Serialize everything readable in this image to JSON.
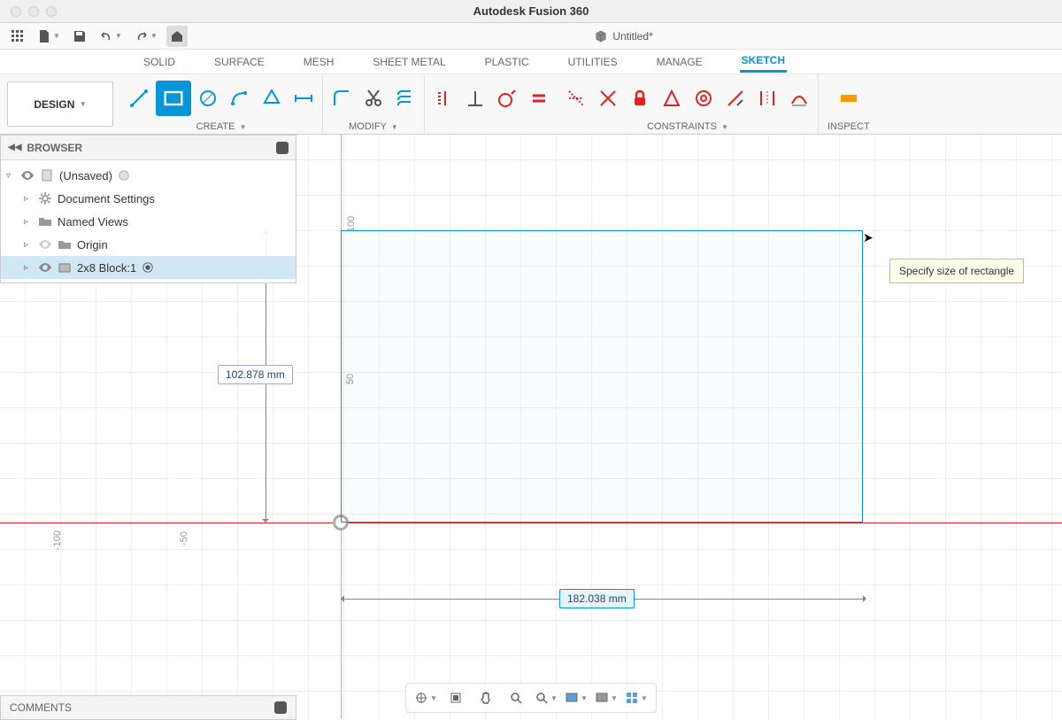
{
  "app": {
    "title": "Autodesk Fusion 360",
    "document": "Untitled*"
  },
  "workspace": {
    "label": "DESIGN"
  },
  "ribbon_tabs": [
    "SOLID",
    "SURFACE",
    "MESH",
    "SHEET METAL",
    "PLASTIC",
    "UTILITIES",
    "MANAGE",
    "SKETCH"
  ],
  "ribbon_active": "SKETCH",
  "ribbon_groups": {
    "create": "CREATE",
    "modify": "MODIFY",
    "constraints": "CONSTRAINTS",
    "inspect": "INSPECT"
  },
  "browser": {
    "title": "BROWSER",
    "root": "(Unsaved)",
    "items": [
      {
        "label": "Document Settings"
      },
      {
        "label": "Named Views"
      },
      {
        "label": "Origin"
      },
      {
        "label": "2x8 Block:1",
        "selected": true
      }
    ]
  },
  "canvas": {
    "axis_ticks_x": {
      "n100": "-100",
      "n50": "-50"
    },
    "axis_ticks_y": {
      "p100": "100",
      "p50": "50"
    },
    "height_dim": "102.878 mm",
    "width_dim": "182.038 mm",
    "tooltip": "Specify size of rectangle"
  },
  "comments": {
    "title": "COMMENTS"
  }
}
